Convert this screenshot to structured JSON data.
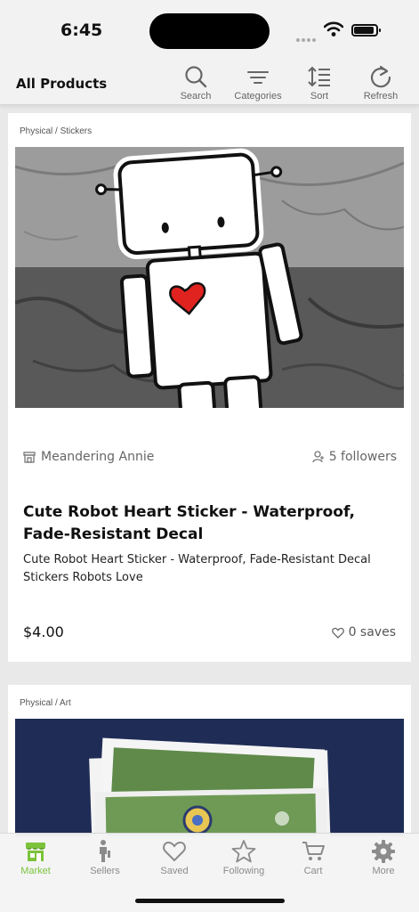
{
  "status": {
    "time": "6:45"
  },
  "header": {
    "title": "All Products",
    "actions": [
      {
        "label": "Search",
        "icon": "search-icon"
      },
      {
        "label": "Categories",
        "icon": "categories-icon"
      },
      {
        "label": "Sort",
        "icon": "sort-icon"
      },
      {
        "label": "Refresh",
        "icon": "refresh-icon"
      }
    ]
  },
  "products": [
    {
      "category": "Physical / Stickers",
      "seller": "Meandering Annie",
      "followers": "5 followers",
      "title": "Cute Robot Heart Sticker - Waterproof, Fade-Resistant Decal",
      "description": "Cute Robot Heart Sticker - Waterproof, Fade-Resistant Decal Stickers Robots Love",
      "price": "$4.00",
      "saves": "0 saves"
    },
    {
      "category": "Physical / Art"
    }
  ],
  "tabs": [
    {
      "label": "Market",
      "icon": "market-icon",
      "active": true
    },
    {
      "label": "Sellers",
      "icon": "sellers-icon"
    },
    {
      "label": "Saved",
      "icon": "heart-icon"
    },
    {
      "label": "Following",
      "icon": "star-icon"
    },
    {
      "label": "Cart",
      "icon": "cart-icon"
    },
    {
      "label": "More",
      "icon": "gear-icon"
    }
  ],
  "colors": {
    "accent": "#7cc33a",
    "muted": "#8b8b8b",
    "heart": "#e0231f",
    "art_bg": "#1f2c56"
  }
}
